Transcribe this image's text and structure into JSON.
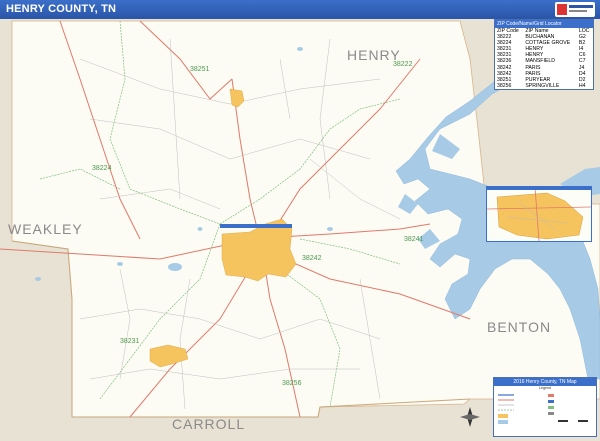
{
  "header": {
    "title": "HENRY COUNTY, TN"
  },
  "map": {
    "county_labels": {
      "henry": "HENRY",
      "weakley": "WEAKLEY",
      "benton": "BENTON",
      "carroll": "CARROLL"
    },
    "zip_labels": [
      "38251",
      "38222",
      "38224",
      "38242",
      "38231",
      "38256",
      "38241"
    ],
    "colors": {
      "water": "#a7cbe6",
      "urban": "#f6c45e",
      "neighbor": "#e7e2d3",
      "county": "#fcfbf4",
      "zip_line": "#7fbf7f",
      "road_major": "#e07a6a",
      "road_minor": "#b9b9b9"
    }
  },
  "zip_table": {
    "title": "ZIP Code/Name/Grid Locator",
    "columns": [
      "ZIP Code",
      "ZIP Name",
      "LOC"
    ],
    "rows": [
      [
        "38222",
        "BUCHANAN",
        "G2"
      ],
      [
        "38224",
        "COTTAGE GROVE",
        "B2"
      ],
      [
        "38231",
        "HENRY",
        "I4"
      ],
      [
        "38231",
        "HENRY",
        "C6"
      ],
      [
        "38236",
        "MANSFIELD",
        "C7"
      ],
      [
        "38242",
        "PARIS",
        "J4"
      ],
      [
        "38242",
        "PARIS",
        "D4"
      ],
      [
        "38251",
        "PURYEAR",
        "D2"
      ],
      [
        "38256",
        "SPRINGVILLE",
        "H4"
      ]
    ]
  },
  "legend": {
    "title": "2016 Henry County, TN Map",
    "subtitle": "Legend"
  }
}
